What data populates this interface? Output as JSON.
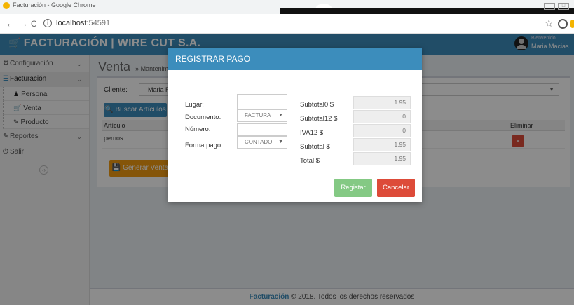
{
  "browser": {
    "tab_title": "Facturación - Google Chrome",
    "url_host": "localhost",
    "url_port": ":54591",
    "nav_back": "←",
    "nav_forward": "→",
    "nav_reload": "C",
    "info_icon": "ⓘ",
    "star_icon": "☆",
    "min_icon": "–",
    "max_icon": "□"
  },
  "header": {
    "brand": "FACTURACIÓN | WIRE CUT S.A.",
    "cart_icon": "🛒",
    "welcome": "Bienvenido",
    "username": "Maria Macias"
  },
  "sidebar": {
    "items": [
      {
        "label": "Configuración",
        "icon": "⚙",
        "chevron": "⌄"
      },
      {
        "label": "Facturación",
        "icon": "☰",
        "chevron": "⌄"
      },
      {
        "label": "Reportes",
        "icon": "✎",
        "chevron": "⌄"
      },
      {
        "label": "Salir",
        "icon": "⏻"
      }
    ],
    "subitems": [
      {
        "label": "Persona",
        "icon": "♟"
      },
      {
        "label": "Venta",
        "icon": "🛒"
      },
      {
        "label": "Producto",
        "icon": "✎"
      }
    ],
    "toggle_icon": "‹›"
  },
  "main": {
    "title": "Venta",
    "breadcrumb": "» Mantenimiento",
    "cliente_label": "Cliente:",
    "cliente_value": "Maria Ro",
    "search_button": "🔍 Buscar Artículos",
    "columns": {
      "articulo": "Artículo",
      "eliminar": "Eliminar"
    },
    "rows": [
      {
        "articulo": "pernos",
        "delete": "×"
      }
    ],
    "generate_button": "💾 Generar Venta"
  },
  "footer": {
    "link": "Facturación",
    "text": " © 2018. Todos los derechos reservados"
  },
  "modal": {
    "title": "REGISTRAR PAGO",
    "fields": {
      "lugar_label": "Lugar:",
      "lugar_value": "",
      "documento_label": "Documento:",
      "documento_value": "FACTURA",
      "numero_label": "Número:",
      "numero_value": "",
      "forma_pago_label": "Forma pago:",
      "forma_pago_value": "CONTADO",
      "dropdown_icon": "▼"
    },
    "totals": {
      "subtotal0_label": "Subtotal0 $",
      "subtotal0_value": "1.95",
      "subtotal12_label": "Subtotal12 $",
      "subtotal12_value": "0",
      "iva12_label": "IVA12 $",
      "iva12_value": "0",
      "subtotal_label": "Subtotal $",
      "subtotal_value": "1.95",
      "total_label": "Total $",
      "total_value": "1.95"
    },
    "register_button": "Registar",
    "cancel_button": "Cancelar"
  }
}
